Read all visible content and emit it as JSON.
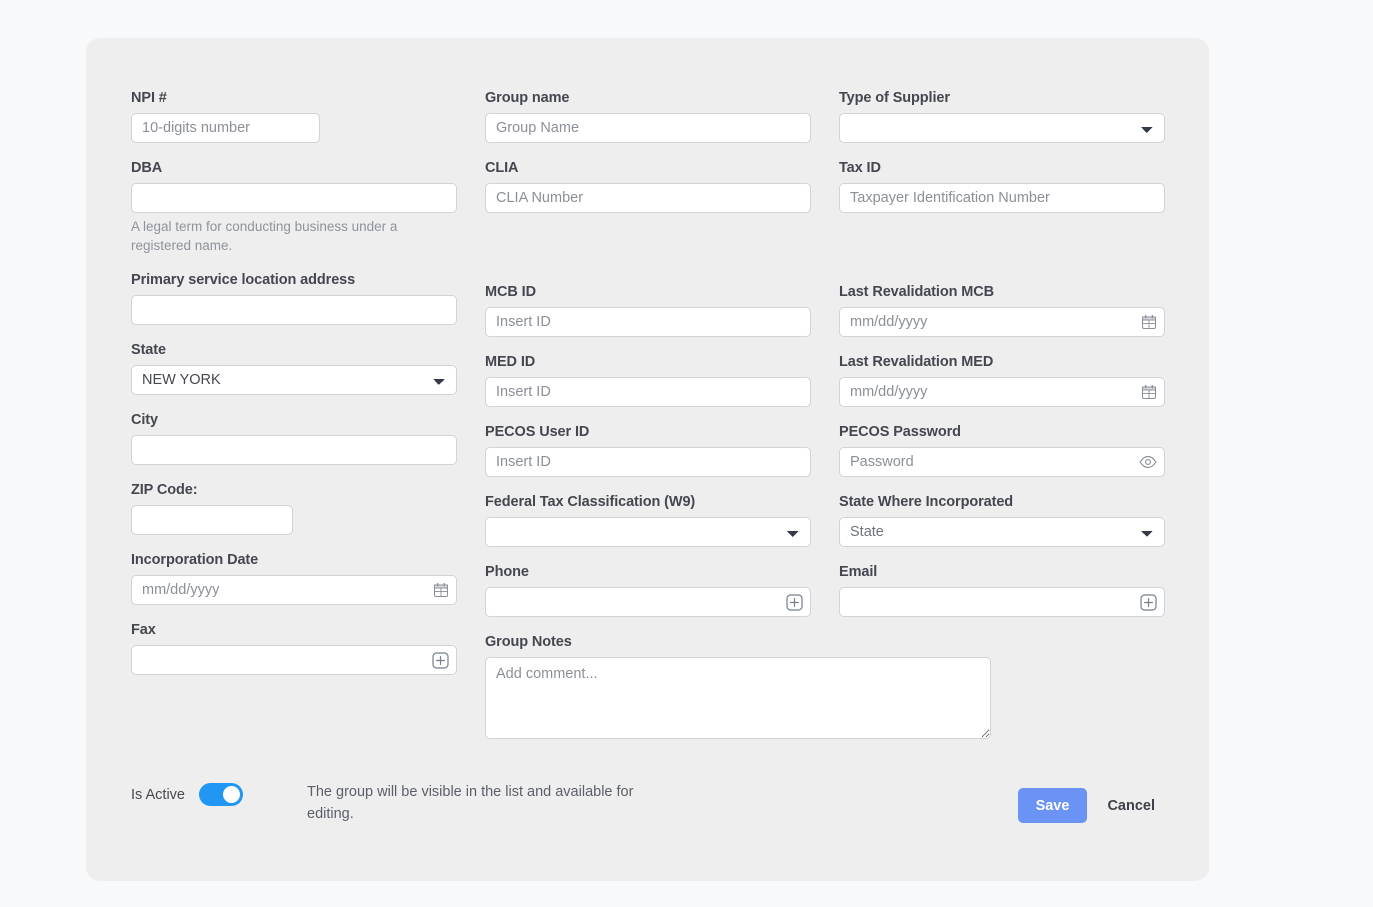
{
  "form": {
    "columns": {
      "left": {
        "npi": {
          "label": "NPI #",
          "placeholder": "10-digits number",
          "value": ""
        },
        "dba": {
          "label": "DBA",
          "placeholder": "",
          "value": "",
          "hint": "A legal term for conducting business under a registered name."
        },
        "address": {
          "label": "Primary service location address",
          "placeholder": "",
          "value": ""
        },
        "state": {
          "label": "State",
          "value": "NEW YORK",
          "options": [
            "NEW YORK"
          ]
        },
        "city": {
          "label": "City",
          "placeholder": "",
          "value": ""
        },
        "zip": {
          "label": "ZIP Code:",
          "placeholder": "",
          "value": ""
        },
        "incorporation_date": {
          "label": "Incorporation Date",
          "placeholder": "mm/dd/yyyy",
          "value": "",
          "icon": "calendar-icon"
        },
        "fax": {
          "label": "Fax",
          "placeholder": "",
          "value": "",
          "icon": "add-square-icon"
        }
      },
      "middle": {
        "group_name": {
          "label": "Group name",
          "placeholder": "Group Name",
          "value": ""
        },
        "clia": {
          "label": "CLIA",
          "placeholder": "CLIA Number",
          "value": ""
        },
        "mcb_id": {
          "label": "MCB ID",
          "placeholder": "Insert ID",
          "value": ""
        },
        "med_id": {
          "label": "MED ID",
          "placeholder": "Insert ID",
          "value": ""
        },
        "pecos_user_id": {
          "label": "PECOS User ID",
          "placeholder": "Insert ID",
          "value": ""
        },
        "federal_tax_classification": {
          "label": "Federal Tax Classification (W9)",
          "value": "",
          "options": []
        },
        "phone": {
          "label": "Phone",
          "placeholder": "",
          "value": "",
          "icon": "add-square-icon"
        },
        "group_notes": {
          "label": "Group Notes",
          "placeholder": "Add comment...",
          "value": ""
        }
      },
      "right": {
        "type_of_supplier": {
          "label": "Type of Supplier",
          "value": "",
          "options": []
        },
        "tax_id": {
          "label": "Tax ID",
          "placeholder": "Taxpayer Identification Number",
          "value": ""
        },
        "last_revalidation_mcb": {
          "label": "Last Revalidation MCB",
          "placeholder": "mm/dd/yyyy",
          "value": "",
          "icon": "calendar-icon"
        },
        "last_revalidation_med": {
          "label": "Last Revalidation MED",
          "placeholder": "mm/dd/yyyy",
          "value": "",
          "icon": "calendar-icon"
        },
        "pecos_password": {
          "label": "PECOS Password",
          "placeholder": "Password",
          "value": "",
          "icon": "eye-icon"
        },
        "state_where_incorporated": {
          "label": "State Where Incorporated",
          "value": "State",
          "options": [
            "State"
          ]
        },
        "email": {
          "label": "Email",
          "placeholder": "",
          "value": "",
          "icon": "add-square-icon"
        }
      }
    },
    "footer": {
      "is_active_label": "Is Active",
      "is_active_value": true,
      "is_active_description": "The group will be visible in the list and available for editing.",
      "save_label": "Save",
      "cancel_label": "Cancel"
    }
  },
  "colors": {
    "page_background": "#f8f9fb",
    "card_background": "#eeeeef",
    "save_button": "#6b93f6",
    "toggle_on": "#2196f3",
    "label_text": "#44474f",
    "placeholder_text": "#8b9097",
    "input_border": "#ced4da"
  }
}
